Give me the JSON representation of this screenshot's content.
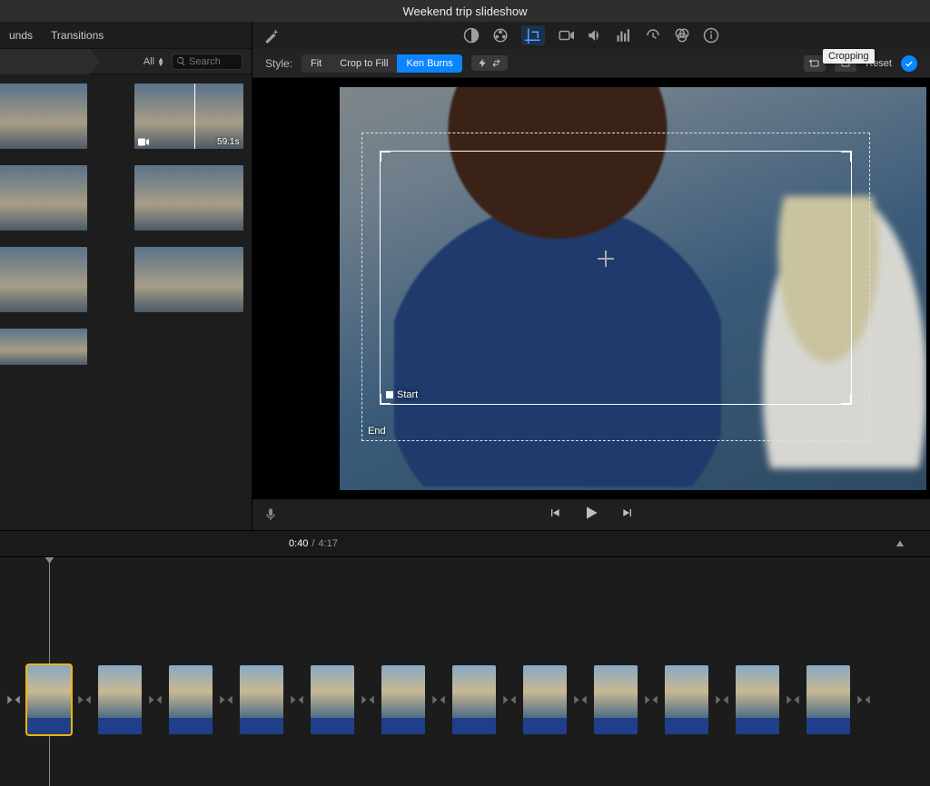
{
  "window": {
    "title": "Weekend trip slideshow"
  },
  "library": {
    "tabs": [
      "unds",
      "Transitions"
    ],
    "filter_all": "All",
    "search_placeholder": "Search",
    "clips": [
      {
        "duration": ""
      },
      {
        "duration": "59.1s",
        "skim": true,
        "cam": true
      },
      {
        "duration": ""
      },
      {
        "duration": ""
      },
      {
        "duration": ""
      },
      {
        "duration": ""
      },
      {
        "duration": ""
      }
    ]
  },
  "toolbar": {
    "tooltip": "Cropping"
  },
  "style": {
    "label": "Style:",
    "options": [
      "Fit",
      "Crop to Fill",
      "Ken Burns"
    ],
    "active": 2,
    "reset": "Reset"
  },
  "kenburns": {
    "start_label": "Start",
    "end_label": "End"
  },
  "time": {
    "current": "0:40",
    "total": "4:17"
  },
  "timeline": {
    "clip_count": 12,
    "selected_index": 0
  }
}
